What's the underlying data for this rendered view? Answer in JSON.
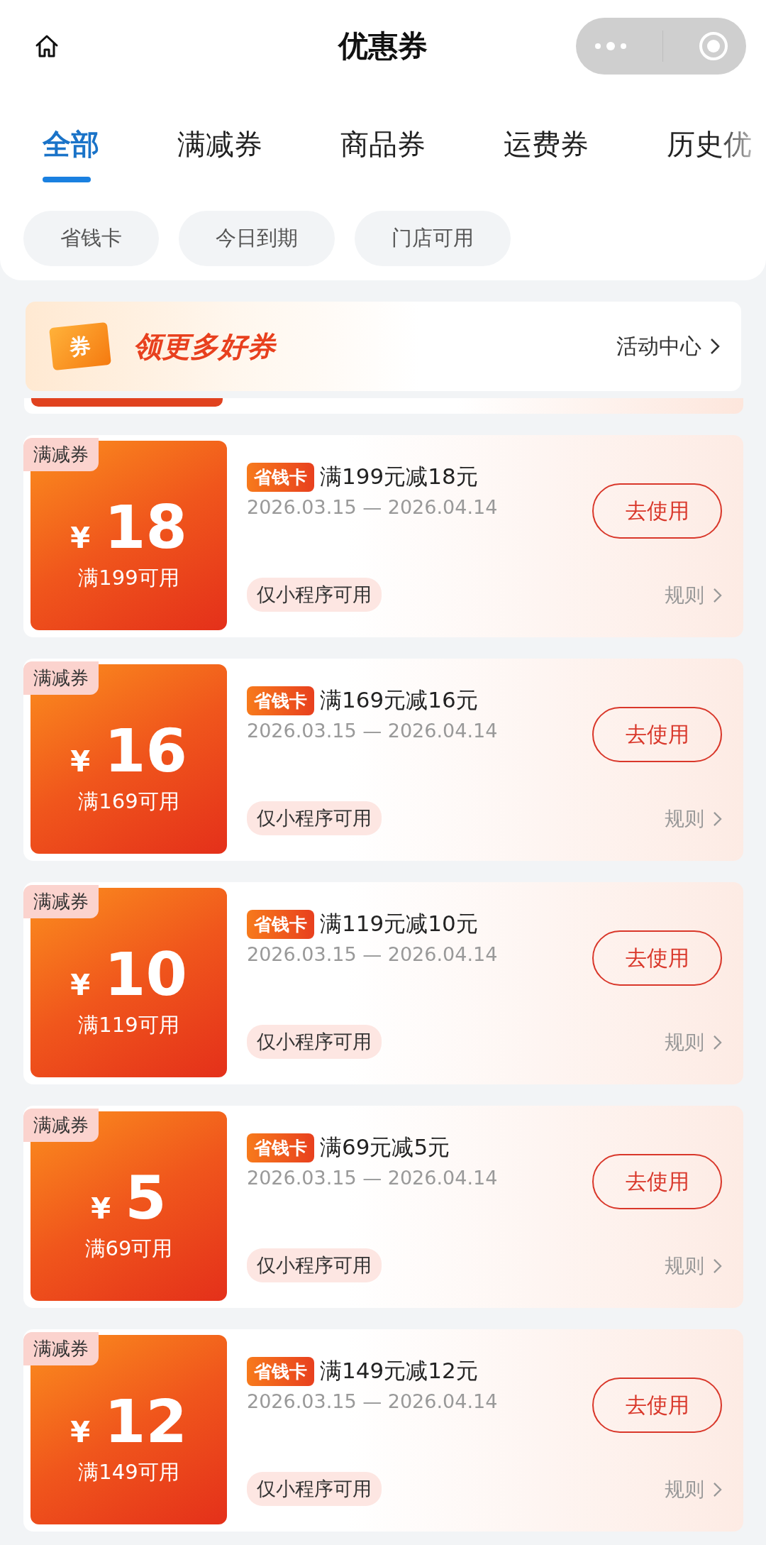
{
  "header": {
    "title": "优惠券"
  },
  "tabs": [
    {
      "label": "全部",
      "selected": true
    },
    {
      "label": "满减券",
      "selected": false
    },
    {
      "label": "商品券",
      "selected": false
    },
    {
      "label": "运费券",
      "selected": false
    },
    {
      "label": "历史优",
      "selected": false
    }
  ],
  "filters": [
    {
      "label": "省钱卡",
      "selected": false
    },
    {
      "label": "今日到期",
      "selected": false
    },
    {
      "label": "门店可用",
      "selected": false
    }
  ],
  "banner": {
    "icon_text": "券",
    "title": "领更多好券",
    "link": "活动中心"
  },
  "coupons": [
    {
      "tag": "满减券",
      "currency": "¥",
      "amount": "18",
      "condition": "满199可用",
      "badge": "省钱卡",
      "title": "满199元减18元",
      "dates": "2026.03.15 — 2026.04.14",
      "button": "去使用",
      "scope": "仅小程序可用",
      "rules": "规则"
    },
    {
      "tag": "满减券",
      "currency": "¥",
      "amount": "16",
      "condition": "满169可用",
      "badge": "省钱卡",
      "title": "满169元减16元",
      "dates": "2026.03.15 — 2026.04.14",
      "button": "去使用",
      "scope": "仅小程序可用",
      "rules": "规则"
    },
    {
      "tag": "满减券",
      "currency": "¥",
      "amount": "10",
      "condition": "满119可用",
      "badge": "省钱卡",
      "title": "满119元减10元",
      "dates": "2026.03.15 — 2026.04.14",
      "button": "去使用",
      "scope": "仅小程序可用",
      "rules": "规则"
    },
    {
      "tag": "满减券",
      "currency": "¥",
      "amount": "5",
      "condition": "满69可用",
      "badge": "省钱卡",
      "title": "满69元减5元",
      "dates": "2026.03.15 — 2026.04.14",
      "button": "去使用",
      "scope": "仅小程序可用",
      "rules": "规则"
    },
    {
      "tag": "满减券",
      "currency": "¥",
      "amount": "12",
      "condition": "满149可用",
      "badge": "省钱卡",
      "title": "满149元减12元",
      "dates": "2026.03.15 — 2026.04.14",
      "button": "去使用",
      "scope": "仅小程序可用",
      "rules": "规则"
    }
  ]
}
